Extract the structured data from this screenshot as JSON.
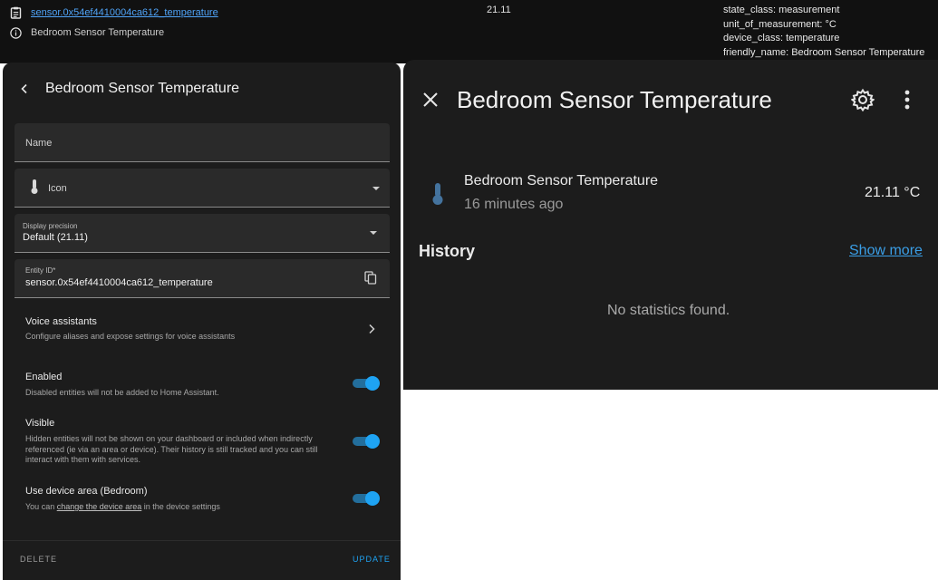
{
  "topbar": {
    "entity_id": "sensor.0x54ef4410004ca612_temperature",
    "friendly": "Bedroom Sensor Temperature",
    "state": "21.11",
    "attributes": [
      "state_class: measurement",
      "unit_of_measurement: °C",
      "device_class: temperature",
      "friendly_name: Bedroom Sensor Temperature"
    ]
  },
  "settings": {
    "title": "Bedroom Sensor Temperature",
    "name_label": "Name",
    "icon_label": "Icon",
    "precision_label": "Display precision",
    "precision_value": "Default (21.11)",
    "entity_id_label": "Entity ID*",
    "entity_id_value": "sensor.0x54ef4410004ca612_temperature",
    "voice_title": "Voice assistants",
    "voice_desc": "Configure aliases and expose settings for voice assistants",
    "enabled_title": "Enabled",
    "enabled_desc": "Disabled entities will not be added to Home Assistant.",
    "visible_title": "Visible",
    "visible_desc": "Hidden entities will not be shown on your dashboard or included when indirectly referenced (ie via an area or device). Their history is still tracked and you can still interact with them with services.",
    "area_title": "Use device area (Bedroom)",
    "area_desc_prefix": "You can ",
    "area_desc_link": "change the device area",
    "area_desc_suffix": " in the device settings",
    "delete_label": "DELETE",
    "update_label": "UPDATE",
    "enabled_on": true,
    "visible_on": true,
    "area_on": true
  },
  "more_info": {
    "title": "Bedroom Sensor Temperature",
    "entity_name": "Bedroom Sensor Temperature",
    "last_changed": "16 minutes ago",
    "value": "21.11 °C",
    "history_title": "History",
    "show_more": "Show more",
    "no_stats": "No statistics found."
  },
  "colors": {
    "accent": "#1ea3f3",
    "link": "#3a9ee6",
    "surface": "#1c1c1c",
    "topbar": "#111111"
  }
}
